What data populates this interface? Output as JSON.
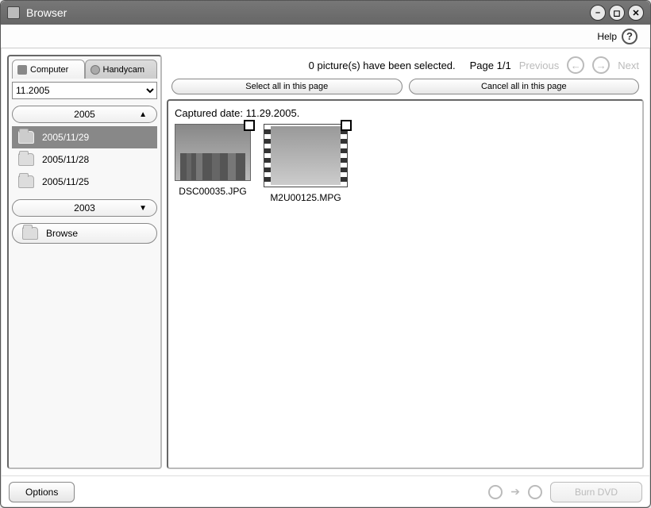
{
  "window": {
    "title": "Browser"
  },
  "help": {
    "label": "Help"
  },
  "sidebar": {
    "tabs": {
      "computer": "Computer",
      "handycam": "Handycam"
    },
    "select_value": "11.2005",
    "year_open": "2005",
    "dates": [
      "2005/11/29",
      "2005/11/28",
      "2005/11/25"
    ],
    "year_closed": "2003",
    "browse": "Browse"
  },
  "main": {
    "status": "0 picture(s) have been selected.",
    "page": "Page 1/1",
    "prev": "Previous",
    "next": "Next",
    "select_all": "Select all in this page",
    "cancel_all": "Cancel all in this page",
    "captured_date": "Captured date: 11.29.2005.",
    "thumbs": [
      {
        "name": "DSC00035.JPG",
        "type": "image"
      },
      {
        "name": "M2U00125.MPG",
        "type": "video"
      }
    ]
  },
  "footer": {
    "options": "Options",
    "burn": "Burn DVD"
  }
}
